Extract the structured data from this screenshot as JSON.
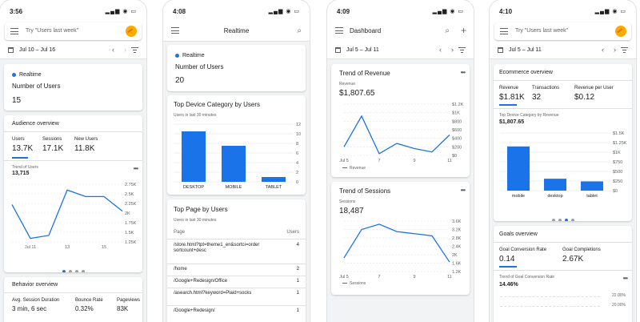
{
  "colors": {
    "accent": "#1a73e8",
    "logo": "#f9ab00"
  },
  "p1": {
    "time": "3:56",
    "search_placeholder": "Try \"Users last week\"",
    "date": "Jul 10 – Jul 16",
    "realtime_label": "Realtime",
    "realtime_metric": "Number of Users",
    "realtime_value": "15",
    "audience": {
      "title": "Audience overview",
      "metrics": [
        {
          "label": "Users",
          "value": "13.7K"
        },
        {
          "label": "Sessions",
          "value": "17.1K"
        },
        {
          "label": "New Users",
          "value": "11.8K"
        }
      ],
      "trend_label": "Trend of Users",
      "trend_value": "13,715",
      "chart_data": {
        "type": "line",
        "x": [
          "Jul 10",
          "Jul 11",
          "Jul 12",
          "Jul 13",
          "Jul 14",
          "Jul 15",
          "Jul 16"
        ],
        "x_tick_labels": [
          "Jul 11",
          "13",
          "15"
        ],
        "values": [
          2220,
          1340,
          1420,
          2600,
          2430,
          2430,
          2050
        ],
        "y_ticks": [
          "2.75K",
          "2.5K",
          "2.25K",
          "2K",
          "1.75K",
          "1.5K",
          "1.25K"
        ],
        "ylim": [
          1250,
          2750
        ]
      }
    },
    "behavior": {
      "title": "Behavior overview",
      "metrics": [
        {
          "label": "Avg. Session Duration",
          "value": "3 min, 6 sec"
        },
        {
          "label": "Bounce Rate",
          "value": "0.32%"
        },
        {
          "label": "Pageviews",
          "value": "83K"
        }
      ]
    }
  },
  "p2": {
    "time": "4:08",
    "title": "Realtime",
    "realtime_label": "Realtime",
    "realtime_metric": "Number of Users",
    "realtime_value": "20",
    "device": {
      "title": "Top Device Category by Users",
      "subtitle": "Users in last 30 minutes",
      "chart_data": {
        "type": "bar",
        "categories": [
          "DESKTOP",
          "MOBILE",
          "TABLET"
        ],
        "values": [
          10.5,
          7.5,
          1
        ],
        "y_ticks": [
          "12",
          "10",
          "8",
          "6",
          "4",
          "2",
          "0"
        ],
        "ylim": [
          0,
          12
        ]
      }
    },
    "pages": {
      "title": "Top Page by Users",
      "subtitle": "Users in last 30 minutes",
      "col_page": "Page",
      "col_users": "Users",
      "rows": [
        {
          "page": "/store.html?tpt=theme1_en&sortci=order sortcount+desc",
          "users": "4"
        },
        {
          "page": "/home",
          "users": "2"
        },
        {
          "page": "/Google+Redesign/Office",
          "users": "1"
        },
        {
          "page": "/asearch.html?keyword=Plaid+socks",
          "users": "1"
        },
        {
          "page": "/Google+Redesign/",
          "users": "1"
        }
      ]
    }
  },
  "p3": {
    "time": "4:09",
    "title": "Dashboard",
    "date": "Jul 5 – Jul 11",
    "revenue": {
      "title": "Trend of Revenue",
      "metric_label": "Revenue",
      "metric_value": "$1,807.65",
      "legend": "Revenue",
      "chart_data": {
        "type": "line",
        "x": [
          "Jul 5",
          "Jul 6",
          "Jul 7",
          "Jul 8",
          "Jul 9",
          "Jul 10",
          "Jul 11"
        ],
        "x_tick_labels": [
          "Jul 5",
          "7",
          "9",
          "11"
        ],
        "values": [
          200,
          920,
          40,
          280,
          160,
          80,
          480
        ],
        "y_ticks": [
          "$1.2K",
          "$1K",
          "$800",
          "$600",
          "$400",
          "$200",
          "$0"
        ],
        "ylim": [
          0,
          1200
        ]
      }
    },
    "sessions": {
      "title": "Trend of Sessions",
      "metric_label": "Sessions",
      "metric_value": "18,487",
      "legend": "Sessions",
      "chart_data": {
        "type": "line",
        "x": [
          "Jul 5",
          "Jul 6",
          "Jul 7",
          "Jul 8",
          "Jul 9",
          "Jul 10",
          "Jul 11"
        ],
        "x_tick_labels": [
          "Jul 5",
          "7",
          "9",
          "11"
        ],
        "values": [
          1850,
          3200,
          3450,
          3100,
          3000,
          2900,
          1650
        ],
        "y_ticks": [
          "3.6K",
          "3.2K",
          "2.8K",
          "2.4K",
          "2K",
          "1.6K",
          "1.2K"
        ],
        "ylim": [
          1200,
          3600
        ]
      }
    }
  },
  "p4": {
    "time": "4:10",
    "search_placeholder": "Try \"Users last week\"",
    "date": "Jul 5 – Jul 11",
    "ecommerce": {
      "title": "Ecommerce overview",
      "metrics": [
        {
          "label": "Revenue",
          "value": "$1.81K"
        },
        {
          "label": "Transactions",
          "value": "32"
        },
        {
          "label": "Revenue per User",
          "value": "$0.12"
        }
      ],
      "device_label": "Top Device Category by Revenue",
      "device_value": "$1,807.65",
      "chart_data": {
        "type": "bar",
        "categories": [
          "mobile",
          "desktop",
          "tablet"
        ],
        "values": [
          1150,
          310,
          240
        ],
        "y_ticks": [
          "$1.5K",
          "$1.25K",
          "$1K",
          "$750",
          "$500",
          "$250",
          "$0"
        ],
        "ylim": [
          0,
          1500
        ]
      }
    },
    "goals": {
      "title": "Goals overview",
      "metrics": [
        {
          "label": "Goal Conversion Rate",
          "value": "0.14"
        },
        {
          "label": "Goal Completions",
          "value": "2.67K"
        }
      ],
      "trend_label": "Trend of Goal Conversion Rate",
      "trend_value": "14.46%",
      "y_ticks": [
        "22.00%",
        "20.00%"
      ]
    }
  }
}
